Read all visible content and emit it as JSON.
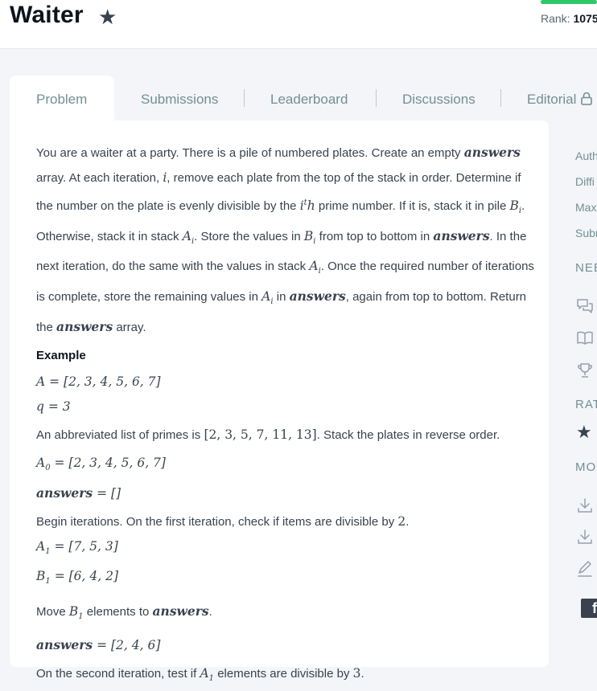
{
  "header": {
    "title": "Waiter",
    "rank_label": "Rank:",
    "rank_value": "1075"
  },
  "tabs": [
    {
      "label": "Problem",
      "active": true
    },
    {
      "label": "Submissions"
    },
    {
      "label": "Leaderboard"
    },
    {
      "label": "Discussions"
    },
    {
      "label": "Editorial"
    }
  ],
  "problem": {
    "t": {
      "s1": "You are a waiter at a party. There is a pile of numbered plates. Create an empty",
      "answers": "answers",
      "s2": "array. At each iteration,",
      "i": "i",
      "s3": ", remove each plate from the top of the stack in order. Determine",
      "s4": "if the number on the plate is evenly divisible by the",
      "ith": "i",
      "ith_sup": "t",
      "ith_h": "h",
      "s5": "prime number. If it is, stack it in",
      "s6": "pile",
      "B": "B",
      "A": "A",
      "sub_i": "i",
      "s7": ". Otherwise, stack it in stack",
      "s8": ". Store the values in",
      "s9": "from top to bottom in",
      "s10": ". In the next iteration, do the same with the values in stack",
      "s11": ". Once the",
      "s12": "required number of iterations is complete, store the remaining values in",
      "s13": "in",
      "s14": ",",
      "s15": "again from top to bottom. Return the",
      "s16": "array."
    },
    "example_heading": "Example",
    "ex": {
      "A_eq": "A = [2, 3, 4, 5, 6, 7]",
      "q_eq": "q = 3",
      "primes_pre": "An abbreviated list of primes is",
      "primes": "[2, 3, 5, 7, 11, 13]",
      "primes_post": ". Stack the plates in reverse order.",
      "A0": "A",
      "A0_sub": "0",
      "A0_val": " = [2, 3, 4, 5, 6, 7]",
      "ans0": "answers",
      "ans0_val": " = []",
      "iter1_pre": "Begin iterations. On the first iteration, check if items are divisible by",
      "iter1_num": "2",
      "iter1_post": ".",
      "A1": "A",
      "A1_sub": "1",
      "A1_val": " = [7, 5, 3]",
      "B1": "B",
      "B1_sub": "1",
      "B1_val": " = [6, 4, 2]",
      "move_pre": "Move",
      "move_B": "B",
      "move_sub": "1",
      "move_mid": "elements to",
      "move_ans": "answers",
      "move_post": ".",
      "ans1": "answers",
      "ans1_val": " = [2, 4, 6]",
      "iter2_pre": "On the second iteration, test if",
      "iter2_A": "A",
      "iter2_sub": "1",
      "iter2_mid": "elements are divisible by",
      "iter2_num": "3",
      "iter2_post": "."
    }
  },
  "sidebar": {
    "labels": [
      "Auth",
      "Diffi",
      "Max",
      "Subr"
    ],
    "need_heading": "NEE",
    "rating_heading": "RAT",
    "more_heading": "MO",
    "facebook": "f",
    "icons": [
      "discussion-icon",
      "book-icon",
      "trophy-icon",
      "star-icon",
      "download-icon",
      "download-icon",
      "edit-icon",
      "facebook-icon"
    ]
  },
  "colors": {
    "accent_green": "#2ec866",
    "text": "#39424e",
    "tab_inactive": "#738f93",
    "background": "#f3f5f8"
  }
}
